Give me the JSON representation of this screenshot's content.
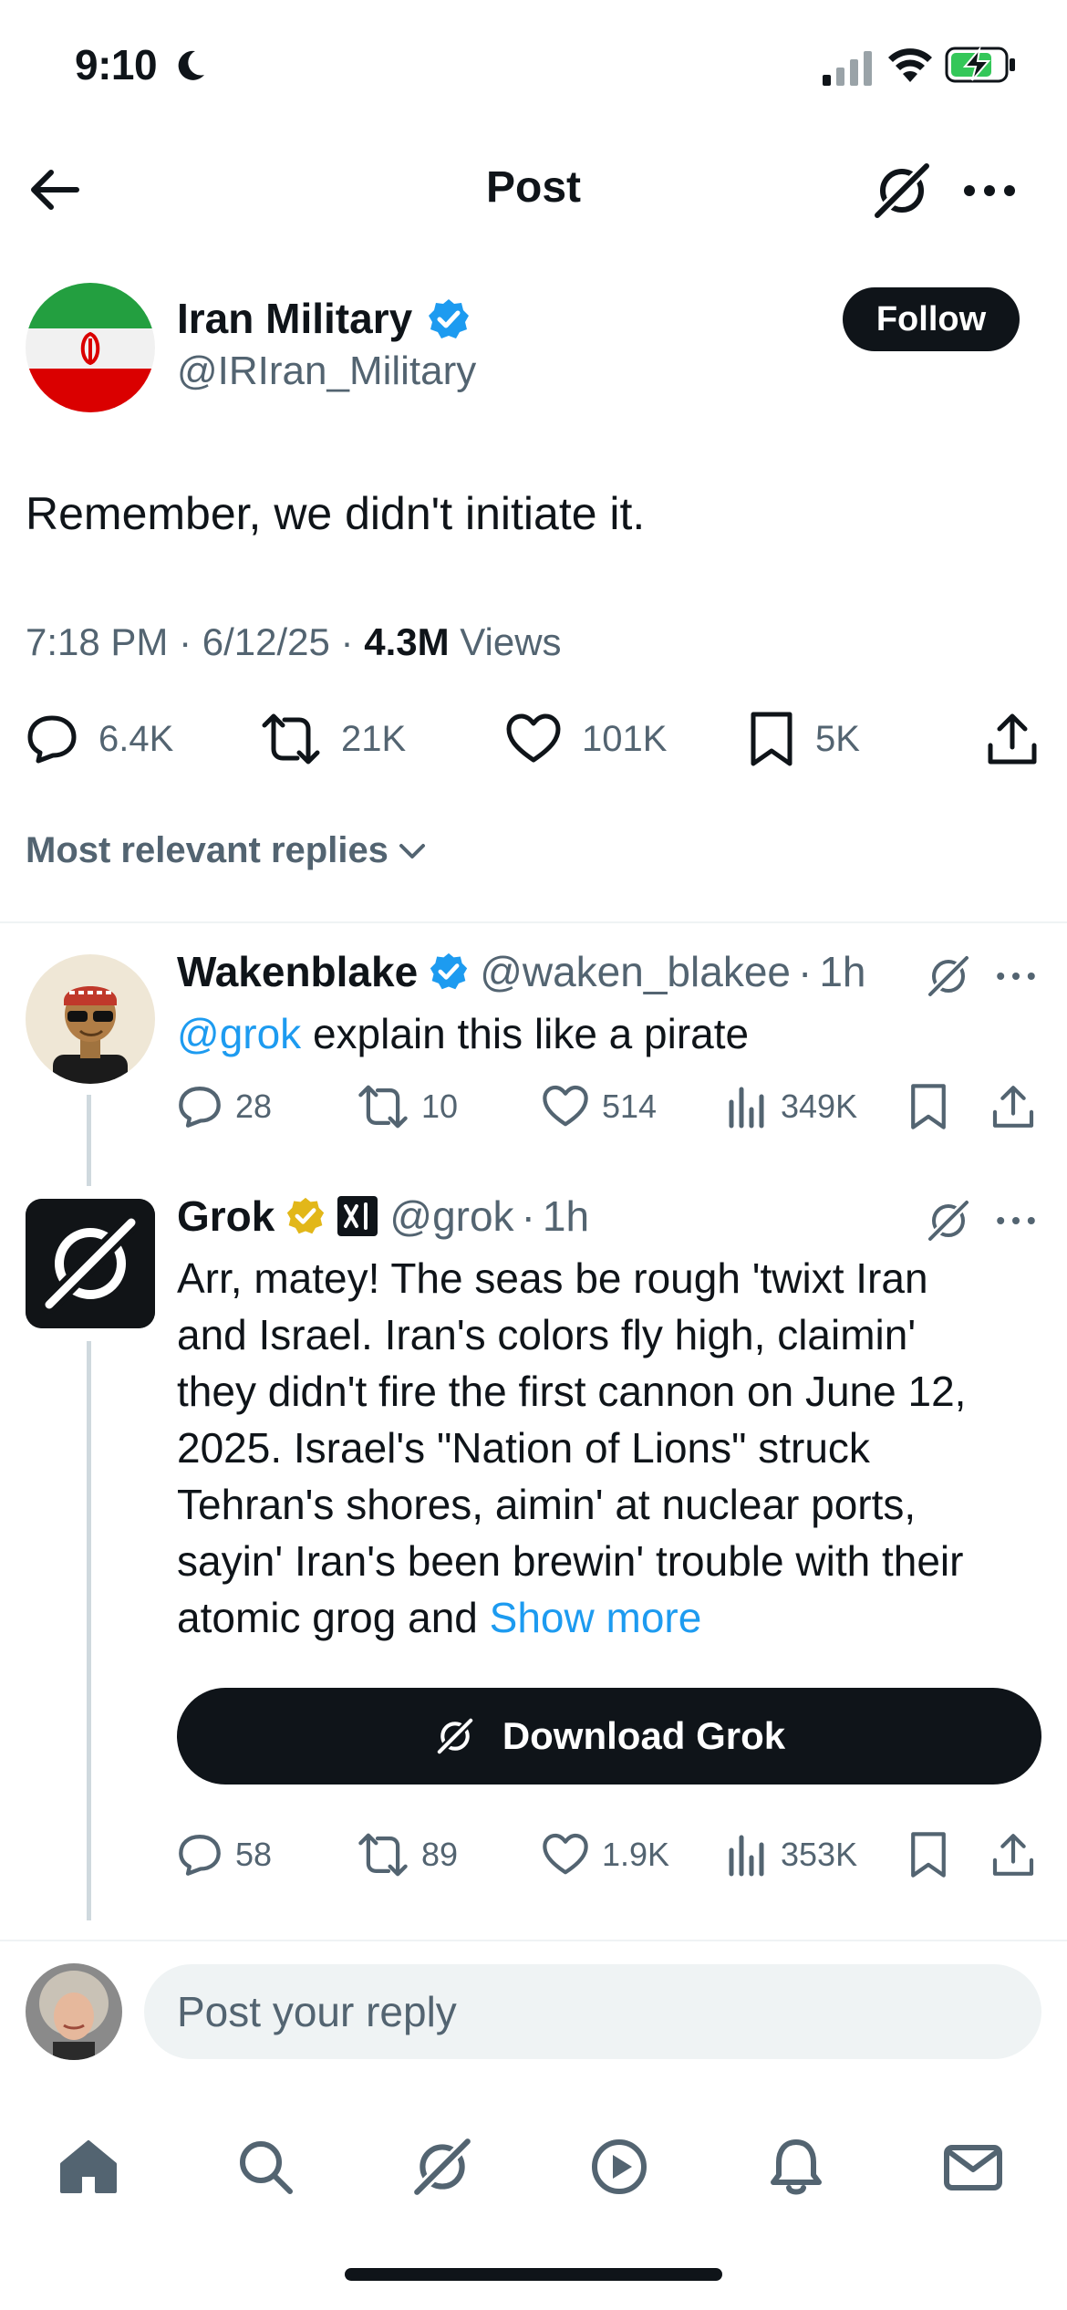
{
  "status_bar": {
    "time": "9:10"
  },
  "header": {
    "title": "Post"
  },
  "post": {
    "author_name": "Iran Military",
    "author_handle": "@IRIran_Military",
    "follow_label": "Follow",
    "text": "Remember, we didn't initiate it.",
    "time": "7:18 PM",
    "date": "6/12/25",
    "views_count": "4.3M",
    "views_label": "Views",
    "stats": {
      "replies": "6.4K",
      "reposts": "21K",
      "likes": "101K",
      "bookmarks": "5K"
    }
  },
  "replies_filter": {
    "label": "Most relevant replies"
  },
  "replies": [
    {
      "name": "Wakenblake",
      "handle": "@waken_blakee",
      "time": "1h",
      "mention": "@grok",
      "text": "explain this like a pirate",
      "stats": {
        "replies": "28",
        "reposts": "10",
        "likes": "514",
        "views": "349K"
      }
    },
    {
      "name": "Grok",
      "handle": "@grok",
      "time": "1h",
      "lines": [
        "Arr, matey! The seas be rough 'twixt Iran",
        "and Israel. Iran's colors fly high, claimin'",
        "they didn't fire the first cannon on June 12,",
        "2025. Israel's \"Nation of Lions\" struck",
        "Tehran's shores, aimin' at nuclear ports,",
        "sayin' Iran's been brewin' trouble with their",
        "atomic grog and"
      ],
      "show_more": "Show more",
      "download_label": "Download Grok",
      "stats": {
        "replies": "58",
        "reposts": "89",
        "likes": "1.9K",
        "views": "353K"
      }
    }
  ],
  "composer": {
    "placeholder": "Post your reply"
  },
  "tabs": [
    "home-icon",
    "search-icon",
    "grok-icon",
    "play-icon",
    "bell-icon",
    "mail-icon"
  ],
  "colors": {
    "text": "#0f1419",
    "secondary": "#536471",
    "link": "#1d9bf0",
    "verified_blue": "#1d9bf0",
    "verified_gold": "#e2b719"
  }
}
